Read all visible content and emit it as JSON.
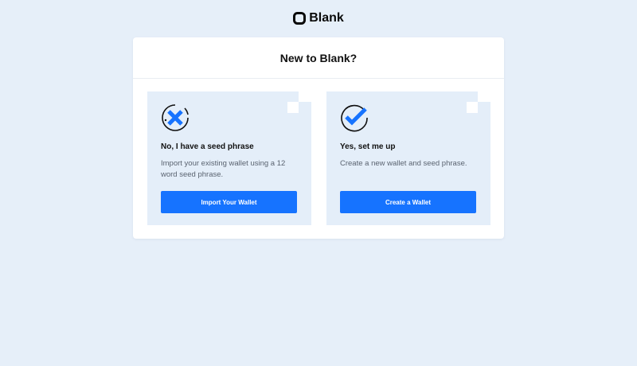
{
  "brand": {
    "name": "Blank"
  },
  "panel": {
    "title": "New to Blank?"
  },
  "cards": [
    {
      "icon": "x-circle-icon",
      "title": "No, I have a seed phrase",
      "description": "Import your existing wallet using a 12 word seed phrase.",
      "button_label": "Import Your Wallet"
    },
    {
      "icon": "check-circle-icon",
      "title": "Yes, set me up",
      "description": "Create a new wallet and seed phrase.",
      "button_label": "Create a Wallet"
    }
  ],
  "colors": {
    "accent": "#1673ff",
    "background": "#e6eff9",
    "card": "#e4eef9"
  }
}
